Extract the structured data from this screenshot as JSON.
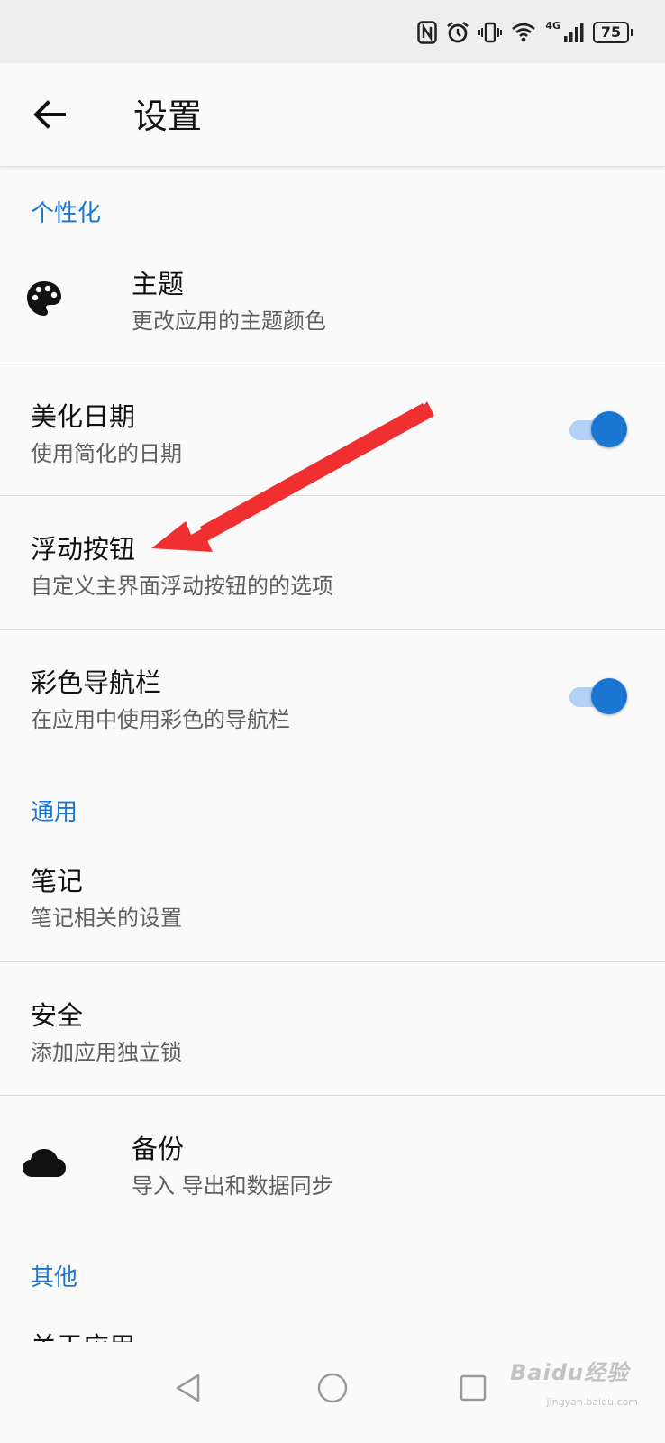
{
  "status_bar": {
    "icons": [
      "nfc-icon",
      "alarm-icon",
      "vibrate-icon",
      "wifi-icon",
      "signal-icon",
      "battery-icon"
    ],
    "network_label": "4G",
    "battery_level": "75"
  },
  "app_bar": {
    "title": "设置",
    "back_icon": "arrow-back-icon"
  },
  "sections": {
    "personalization": "个性化",
    "general": "通用",
    "other": "其他"
  },
  "settings": {
    "theme": {
      "title": "主题",
      "subtitle": "更改应用的主题颜色",
      "icon": "palette-icon"
    },
    "pretty_date": {
      "title": "美化日期",
      "subtitle": "使用简化的日期",
      "toggle_on": true
    },
    "floating_button": {
      "title": "浮动按钮",
      "subtitle": "自定义主界面浮动按钮的的选项"
    },
    "colored_nav": {
      "title": "彩色导航栏",
      "subtitle": "在应用中使用彩色的导航栏",
      "toggle_on": true
    },
    "notes": {
      "title": "笔记",
      "subtitle": "笔记相关的设置"
    },
    "security": {
      "title": "安全",
      "subtitle": "添加应用独立锁"
    },
    "backup": {
      "title": "备份",
      "subtitle": "导入 导出和数据同步",
      "icon": "cloud-icon"
    },
    "about": {
      "title": "关于应用"
    }
  },
  "nav_bar": {
    "buttons": [
      "nav-back-icon",
      "nav-home-icon",
      "nav-recents-icon"
    ]
  },
  "watermark": {
    "text": "Baidu经验",
    "sub": "jingyan.baidu.com"
  },
  "colors": {
    "accent": "#1976d2",
    "toggle_track": "#b3d1f5",
    "annotation_arrow": "#f03030",
    "background": "#fafafa"
  }
}
